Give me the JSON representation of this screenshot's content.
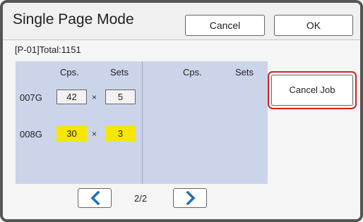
{
  "header": {
    "title": "Single Page Mode",
    "cancel_label": "Cancel",
    "ok_label": "OK"
  },
  "job_info": "[P-01]Total:1151",
  "left_panel": {
    "col_copies": "Cps.",
    "col_sets": "Sets",
    "rows": [
      {
        "label": "007G",
        "copies": "42",
        "sets": "5",
        "highlighted": false
      },
      {
        "label": "008G",
        "copies": "30",
        "sets": "3",
        "highlighted": true
      }
    ],
    "times_symbol": "×"
  },
  "right_panel": {
    "col_copies": "Cps.",
    "col_sets": "Sets"
  },
  "cancel_job_label": "Cancel Job",
  "pagination": {
    "indicator": "2/2",
    "prev_icon": "chevron-left-icon",
    "next_icon": "chevron-right-icon"
  },
  "colors": {
    "highlight": "#f7e600",
    "panel": "#ccd4ea",
    "accent_blue": "#1e6fb8",
    "cancel_job_border": "#dd2020"
  }
}
